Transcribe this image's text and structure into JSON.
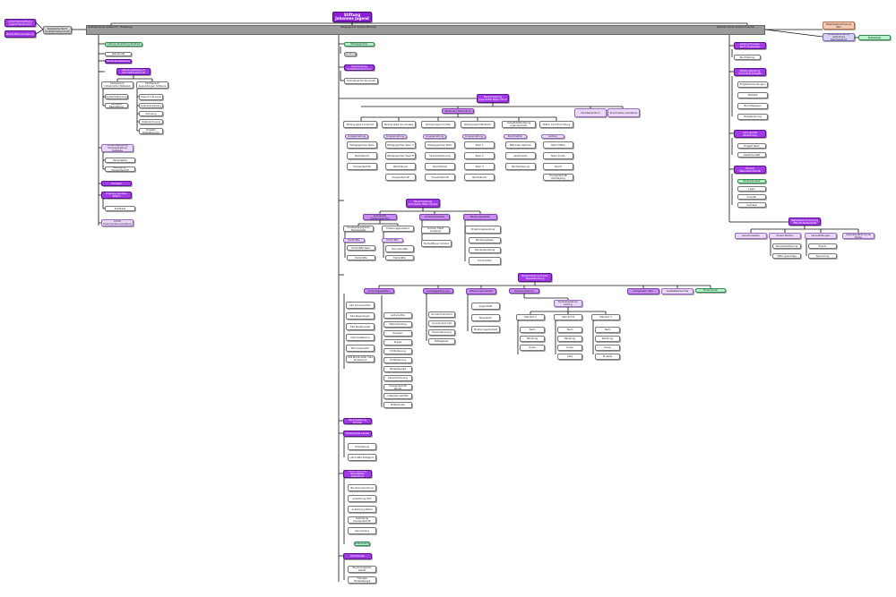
{
  "colors": {
    "root": "#8a1fd6",
    "dark": "#a23ae6",
    "mid": "#c98bf2",
    "light": "#ead7fb",
    "plain": "#ffffff",
    "green": "#b9f2c8",
    "gray": "#d3d3d3",
    "salmon": "#f6c9b5",
    "connector": "#111111"
  },
  "root": {
    "title": "Stiftung Johannes Jugend"
  },
  "band": {
    "left_label": "Kaufmännischer Vorstand IT / Verwaltung",
    "center_label": "Pädagogischer Vorstand Bereiche",
    "right_label": "Kaufmännischer Vorstand Finanzen"
  },
  "side_left": {
    "box1": "Aufsichtsrat Stiftung Jugend Kuratorium",
    "box2": "Beirat Elternvertretung",
    "box3": "Stabsstelle Recht Qualität Datenschutz"
  },
  "side_right": {
    "box1": "Mitarbeitervertretung MAV",
    "box2": "Schwerbehinderten vertretung Gleichstellung",
    "box3": "Stabsstelle"
  },
  "left_branch": {
    "b1": "Leitung Verwaltung Zentrale",
    "b2": "Sekretariat",
    "b3": "Personalverwaltung",
    "b4": "Abteilungsleitung IT Informationstechnik",
    "b4a": "Fachbereich Infrastruktur Netzwerk",
    "b4b": "Fachbereich Anwendungen Software",
    "b4a1": "Systembetreuung",
    "b4a2": "Hardware Beschaffung",
    "b4b1": "Support 1st Level",
    "b4b2": "Lizenzverwaltung",
    "b4b3": "Schulung",
    "b4b4": "Datensicherung",
    "b4b5": "Projekte Digitalisierung",
    "b5": "Abteilungsleitung Hausverwaltung Gebäude",
    "b5a": "Hausmeister",
    "b5b": "Reinigung / Hauswirtschaft",
    "b6": "Fuhrpark",
    "b7": "Empfang Zentrale Telefon",
    "b7a": "Poststelle",
    "b8": "Archiv Dokumentenverwaltung"
  },
  "center_top": {
    "c1": "Assistenz Pädagogischer Vorstand",
    "c1a": "Sekretariat",
    "c2": "Fachberatung Qualitätsentwicklung",
    "c2a": "Fachdienst Kinderschutz"
  },
  "region_a": {
    "head": "Bereichsleitung Jugendhilfe Region Nord",
    "sub": "Stationäre Hilfen Nord",
    "side1": "Fachdienst Nord",
    "side2": "Koordination Aufnahme",
    "cols": [
      {
        "head": "Wohngruppe Lindenhof",
        "tag": "Gruppenleitung",
        "items": [
          "Pädagogisches Team",
          "Nachtdienst",
          "Hauswirtschaft"
        ]
      },
      {
        "head": "Wohngruppe Sonnenweg",
        "tag": "Gruppenleitung",
        "items": [
          "Pädagogisches Team A",
          "Pädagogisches Team B",
          "Nachtdienst",
          "Hauswirtschaft"
        ]
      },
      {
        "head": "Wohngruppe Am Park",
        "tag": "Gruppenleitung",
        "items": [
          "Pädagogisches Team",
          "Intensivbetreuung",
          "Nachtdienst",
          "Hauswirtschaft"
        ]
      },
      {
        "head": "Wohngruppe Mühlbach",
        "tag": "Gruppenleitung",
        "items": [
          "Team 1",
          "Team 2",
          "Team 3",
          "Nachtdienst"
        ]
      },
      {
        "head": "Verselbstständigung Jugendwohnen",
        "tag": "Koordination",
        "items": [
          "Betreutes Wohnen",
          "Apartments",
          "Nachbetreuung"
        ]
      },
      {
        "head": "Mutter Kind Einrichtung",
        "tag": "Leitung",
        "items": [
          "Team Mütter",
          "Team Kinder",
          "Nacht",
          "Hauswirtschaft Verpflegung"
        ]
      }
    ]
  },
  "region_b": {
    "head": "Bereichsleitung Ambulante Hilfen Familie",
    "s1": "Ambulante Erziehungshilfen",
    "s2": "Schulsozialarbeit",
    "s3": "Beratungsstellen",
    "s1a": "Sozialpädagogische Familienhilfe",
    "s1b": "Erziehungsbeistand",
    "s1a1": "Fachkräfte",
    "s1a2": "Fachkräfte Team",
    "s1b1": "Fachkräfte",
    "s1b2": "Honorarkräfte",
    "s2a": "Schulen Stadt Landkreis",
    "s2b": "Fachkräfte an Schulen",
    "s3a": "Erziehungsberatung",
    "s3a1": "Beratungsteam",
    "s3a2": "Familienberatung",
    "s3a3": "Frühe Hilfen"
  },
  "region_c": {
    "head": "Bereichsleitung Kinder Tagesbetreuung",
    "c1": "Kindertagesstätten",
    "c2": "Ganztagsbetreuung",
    "c3": "Offene Jugendarbeit",
    "c4": "Familienzentrum",
    "c5": "Kooperation Kita",
    "c6": "Qualitätszirkel Kita",
    "c7": "Förderverein",
    "c1_items": [
      "Kita Sonnenschein",
      "Kita Regenbogen",
      "Kita Spatzennest",
      "Kita Pusteblume",
      "Kita Löwenzahn",
      "Kita Marienkäfer Villa Kunterbunt"
    ],
    "c1b_items": [
      "Leitung Kita",
      "Stellvertretung",
      "Gruppen",
      "Krippe",
      "U3 Betreuung",
      "Ü3 Betreuung",
      "Heilpädagogik",
      "Sprachförderung",
      "Hauswirtschaft Küche",
      "Integrationskräfte",
      "Praktikanten"
    ],
    "c2_items": [
      "Grundschule Nord",
      "Grundschule Süd",
      "Ferienbetreuung",
      "Mittagessen"
    ],
    "c3_items": [
      "Jugendtreff",
      "Streetwork",
      "Mobile Jugendarbeit"
    ],
    "c4_head": "Familienzentrum Leitung",
    "c4_cols": [
      {
        "head": "Standort A",
        "items": [
          "Team",
          "Beratung",
          "Kurse"
        ]
      },
      {
        "head": "Standort B",
        "items": [
          "Team",
          "Beratung",
          "Kurse",
          "Café"
        ]
      },
      {
        "head": "Standort C",
        "items": [
          "Team",
          "Beratung",
          "Kurse",
          "Projekte"
        ]
      }
    ]
  },
  "center_lower": {
    "l1": "Bereichsleitung Schulen",
    "l2": "Förderschule Lernen",
    "l2a": "Schulleitung",
    "l2b": "Lehrkräfte Kollegium",
    "l3": "Bereichsleitung Werkstätten Ausbildung",
    "l3_items": [
      "Berufsvorbereitung",
      "Ausbildung Holz",
      "Ausbildung Metall",
      "Ausbildung Hauswirtschaft",
      "Jobcoaching"
    ],
    "l3_green": "Praktikumsbörse",
    "l4": "Fachdienste",
    "l4_items": [
      "Psychologischer Dienst",
      "Therapie Heilpädagogik"
    ]
  },
  "right_branch": {
    "r1": "Leitung Finanzen Rechnungswesen",
    "r1a": "Buchhaltung",
    "r2": "Abteilungsleitung Controlling Entgelte",
    "r2_items": [
      "Entgeltverhandlungen",
      "Statistik",
      "Berichtswesen",
      "Budgetplanung"
    ],
    "r3": "Lohn Gehalt Abrechnung",
    "r3_items": [
      "Entgelt Team",
      "Zeitwirtschaft"
    ],
    "r4": "Einkauf Materialwirtschaft",
    "r4_green": "Zentraleinkauf",
    "r4_items": [
      "Lager",
      "Inventar",
      "Verträge"
    ],
    "r5": "Stabsstelle Fundraising Öffentlichkeitsarbeit",
    "r5_cols": [
      "Spendenwesen",
      "Presse Medien",
      "Veranstaltungen",
      "Internetauftritt Social Media"
    ],
    "r5_sub1": [
      "Spenderbetreuung",
      "Stiftungsanträge"
    ],
    "r5_sub2": [
      "Events",
      "Sponsoring"
    ]
  }
}
